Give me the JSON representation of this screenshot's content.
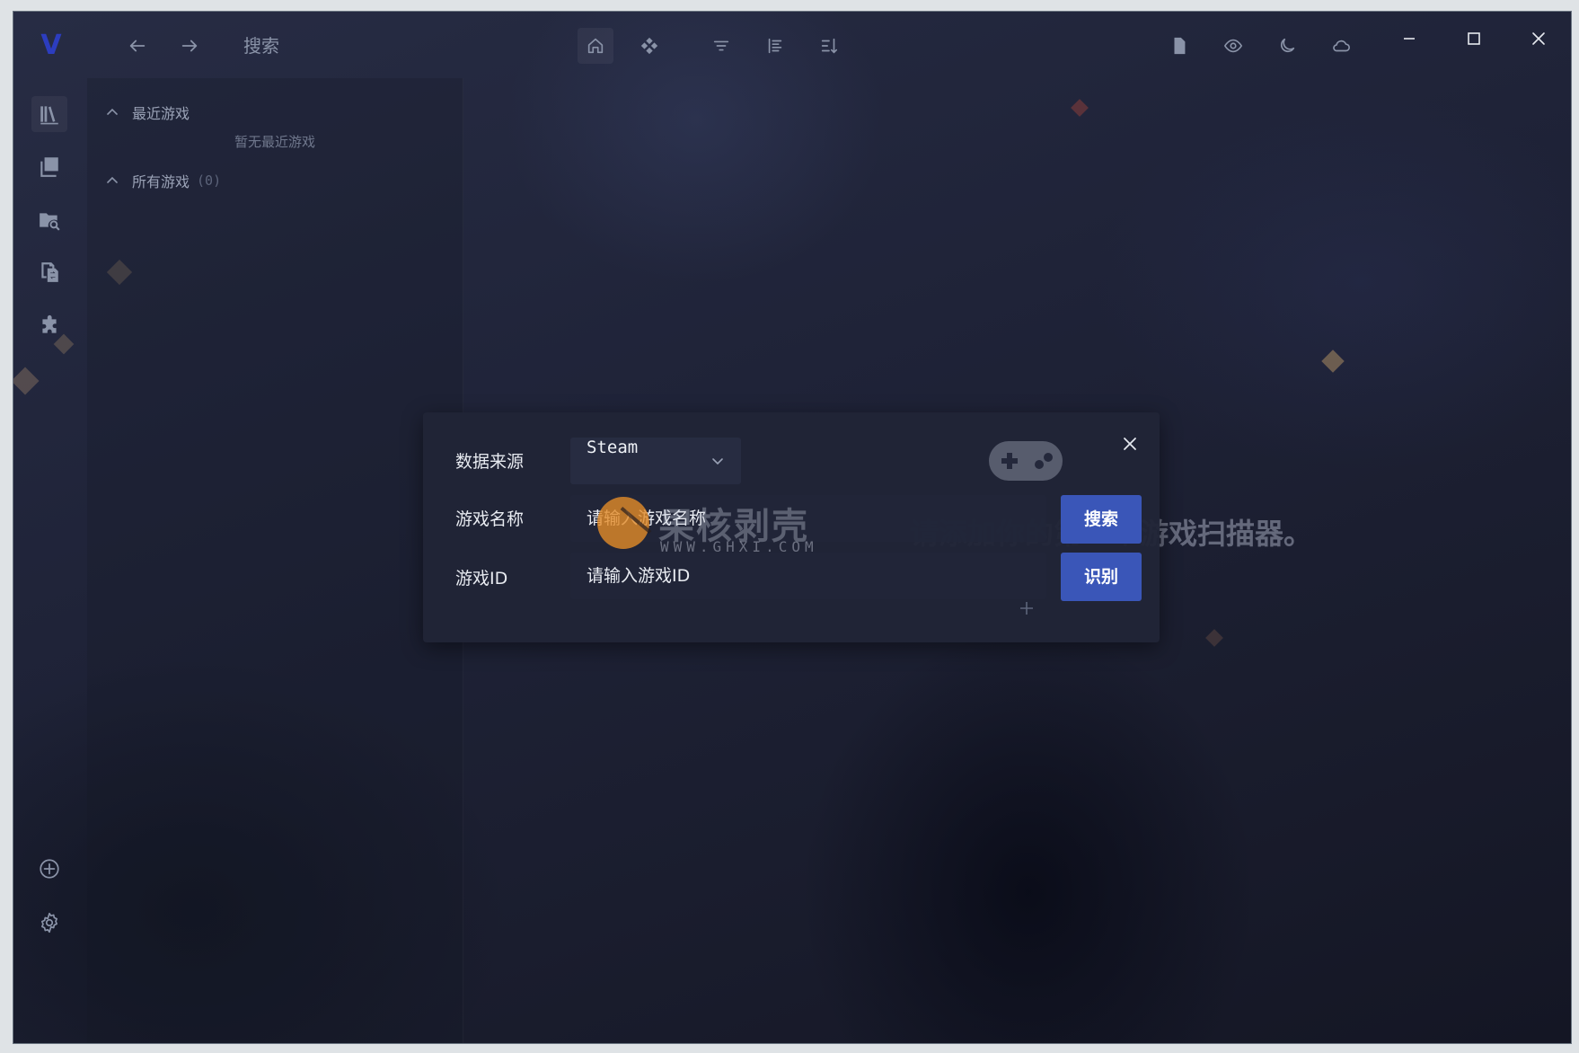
{
  "titlebar": {
    "logo_text": "V",
    "back_icon": "arrow-left-icon",
    "forward_icon": "arrow-right-icon",
    "page_title": "搜索",
    "center_icons": [
      "home-icon",
      "dpad-icon",
      "filter-icon",
      "list-indent-icon",
      "sort-icon"
    ],
    "right_icons": [
      "document-icon",
      "eye-icon",
      "moon-icon",
      "cloud-icon"
    ],
    "window_controls": [
      "minimize-icon",
      "maximize-icon",
      "close-icon"
    ]
  },
  "activity_bar": {
    "items": [
      "library-icon",
      "gallery-icon",
      "folder-search-icon",
      "copy-icon",
      "puzzle-icon"
    ],
    "bottom_items": [
      "add-circle-icon",
      "settings-icon"
    ]
  },
  "library": {
    "recent_group_label": "最近游戏",
    "recent_empty_text": "暂无最近游戏",
    "all_group_label": "所有游戏",
    "all_group_count": "(0)"
  },
  "main": {
    "empty_hint": "请添加你的第一个游戏扫描器。"
  },
  "watermark": {
    "main_text": "果核剥壳",
    "sub_text": "WWW.GHXI.COM"
  },
  "dialog": {
    "source_label": "数据来源",
    "source_value": "Steam",
    "name_label": "游戏名称",
    "name_placeholder": "请输入游戏名称",
    "search_button": "搜索",
    "id_label": "游戏ID",
    "id_placeholder": "请输入游戏ID",
    "identify_button": "识别"
  },
  "colors": {
    "accent": "#3a56b8",
    "background": "#1f2338",
    "dialog_bg": "#202436"
  }
}
